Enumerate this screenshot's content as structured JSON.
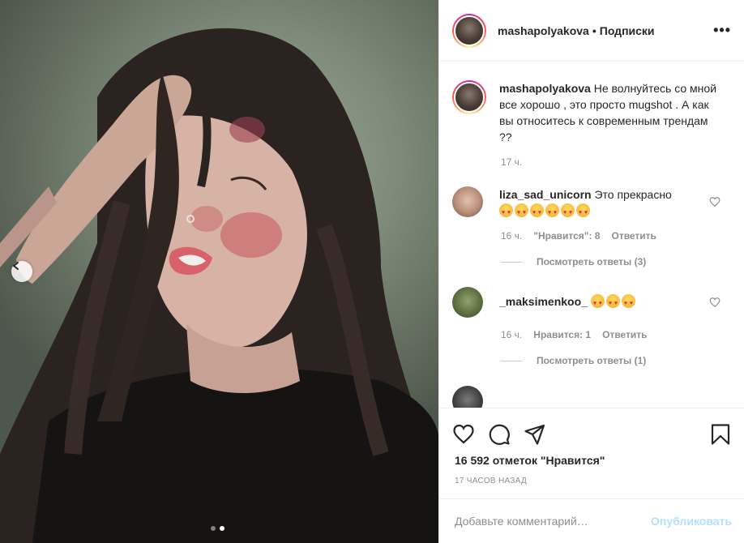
{
  "post": {
    "username": "mashapolyakova",
    "separator": "•",
    "follow_status": "Подписки",
    "more": "•••",
    "caption_text": "Не волнуйтесь со мной все хорошо , это просто mugshot . А как вы относитесь к современным трендам ??",
    "caption_time": "17 ч."
  },
  "comments": [
    {
      "username": "liza_sad_unicorn",
      "text": "Это прекрасно",
      "emoji_count": 6,
      "time": "16 ч.",
      "likes": "\"Нравится\": 8",
      "reply": "Ответить",
      "view_replies": "Посмотреть ответы (3)"
    },
    {
      "username": "_maksimenkoo_",
      "text": "",
      "emoji_count": 3,
      "time": "16 ч.",
      "likes": "Нравится: 1",
      "reply": "Ответить",
      "view_replies": "Посмотреть ответы (1)"
    }
  ],
  "footer": {
    "likes_count": "16 592 отметок \"Нравится\"",
    "post_time": "17 ЧАСОВ НАЗАД",
    "comment_placeholder": "Добавьте комментарий…",
    "publish_label": "Опубликовать"
  },
  "icons": {
    "like": "heart-icon",
    "comment": "comment-icon",
    "share": "share-icon",
    "save": "bookmark-icon"
  },
  "colors": {
    "publish_disabled": "#b2dffc",
    "meta_gray": "#8e8e8e",
    "text": "#262626"
  }
}
